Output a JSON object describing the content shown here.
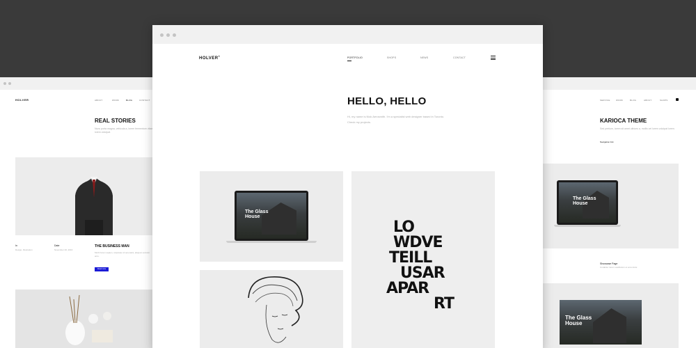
{
  "left_window": {
    "brand": "HOLVER",
    "nav": [
      "ABOUT",
      "WORK",
      "BLOG",
      "CONTACT"
    ],
    "heading": "REAL STORIES",
    "intro": "Nunc porta magna, vehicula a, lorem fermentum vitae lorem volutpat.",
    "card_title": "THE BUSINESS MAN",
    "card_text": "Morbi lorem sapien, vulputate id venenatis, aliquam at dolor arcu.",
    "card_button": "Read more",
    "meta_left": "In",
    "meta_left_sub": "Design, Illustration",
    "meta_mid": "Date",
    "meta_mid_sub": "November 26, 2016"
  },
  "center_window": {
    "brand": "HOLVER",
    "brand_mark": "®",
    "nav": [
      "PORTFOLIO",
      "SHOPS",
      "NEWS",
      "CONTACT"
    ],
    "active_nav": "PORTFOLIO",
    "menu_icon": "hamburger-icon",
    "hero_title": "HELLO, HELLO",
    "hero_text": "Hi, my name is Nick Aerosmith. I'm a specialist web designer based in Toronto.",
    "hero_text_2": "Check my projects.",
    "laptop_label": "The Glass House",
    "typo_lines": [
      "LO",
      "WDVE",
      "TEILL",
      "USAR",
      "APAR",
      "RT"
    ]
  },
  "right_window": {
    "nav": [
      "SERVICE",
      "WORK",
      "BLOG",
      "ABOUT",
      "SHOPS"
    ],
    "cart_icon": "bag-icon",
    "heading": "KARIOCA THEME",
    "intro": "Sed pretium, lorem sit amet ultrices a, mollis vel lorem volutpat lorem.",
    "link": "Navigation link",
    "laptop_label": "The Glass House",
    "caption": "Showcase Page",
    "caption_sub": "Curabitur lorem vestibulum et eros dolor.",
    "thumb_label": "The Glass House"
  },
  "colors": {
    "background": "#3a3a3a",
    "accent_button": "#1b1bd6"
  }
}
